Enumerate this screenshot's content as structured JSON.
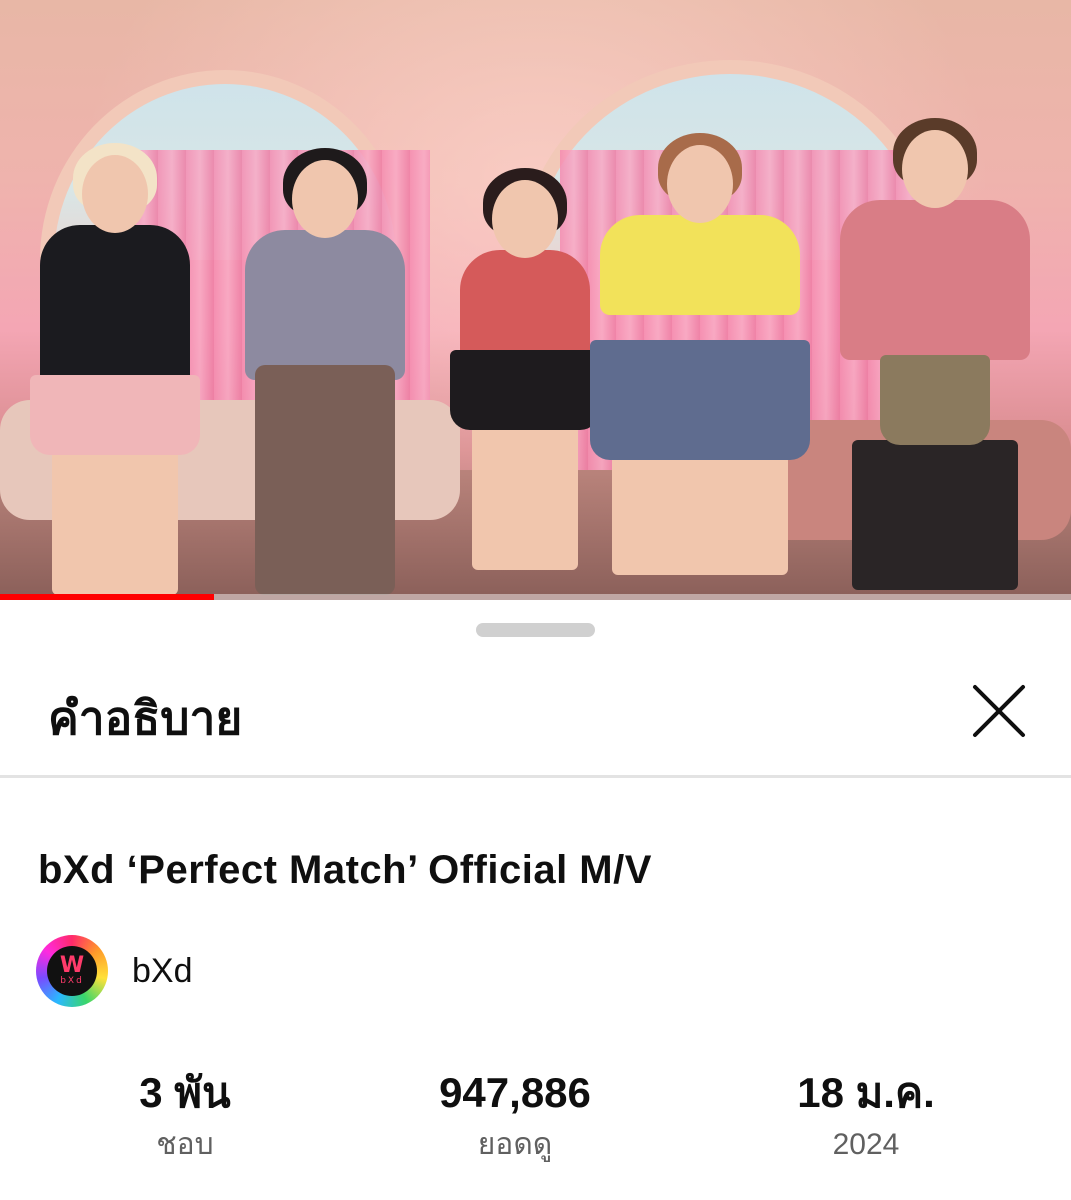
{
  "player": {
    "progress_fraction": 0.2,
    "progress_color": "#ff0000"
  },
  "sheet": {
    "title": "คำอธิบาย",
    "close_icon": "close-icon"
  },
  "video": {
    "title": "bXd ‘Perfect Match’ Official M/V"
  },
  "channel": {
    "name": "bXd",
    "avatar_icon": "channel-avatar",
    "avatar_mark": "W",
    "avatar_small_text": "bXd"
  },
  "stats": {
    "likes": {
      "value": "3 พัน",
      "label": "ชอบ"
    },
    "views": {
      "value": "947,886",
      "label": "ยอดดู"
    },
    "date": {
      "value": "18 ม.ค.",
      "label": "2024"
    }
  }
}
